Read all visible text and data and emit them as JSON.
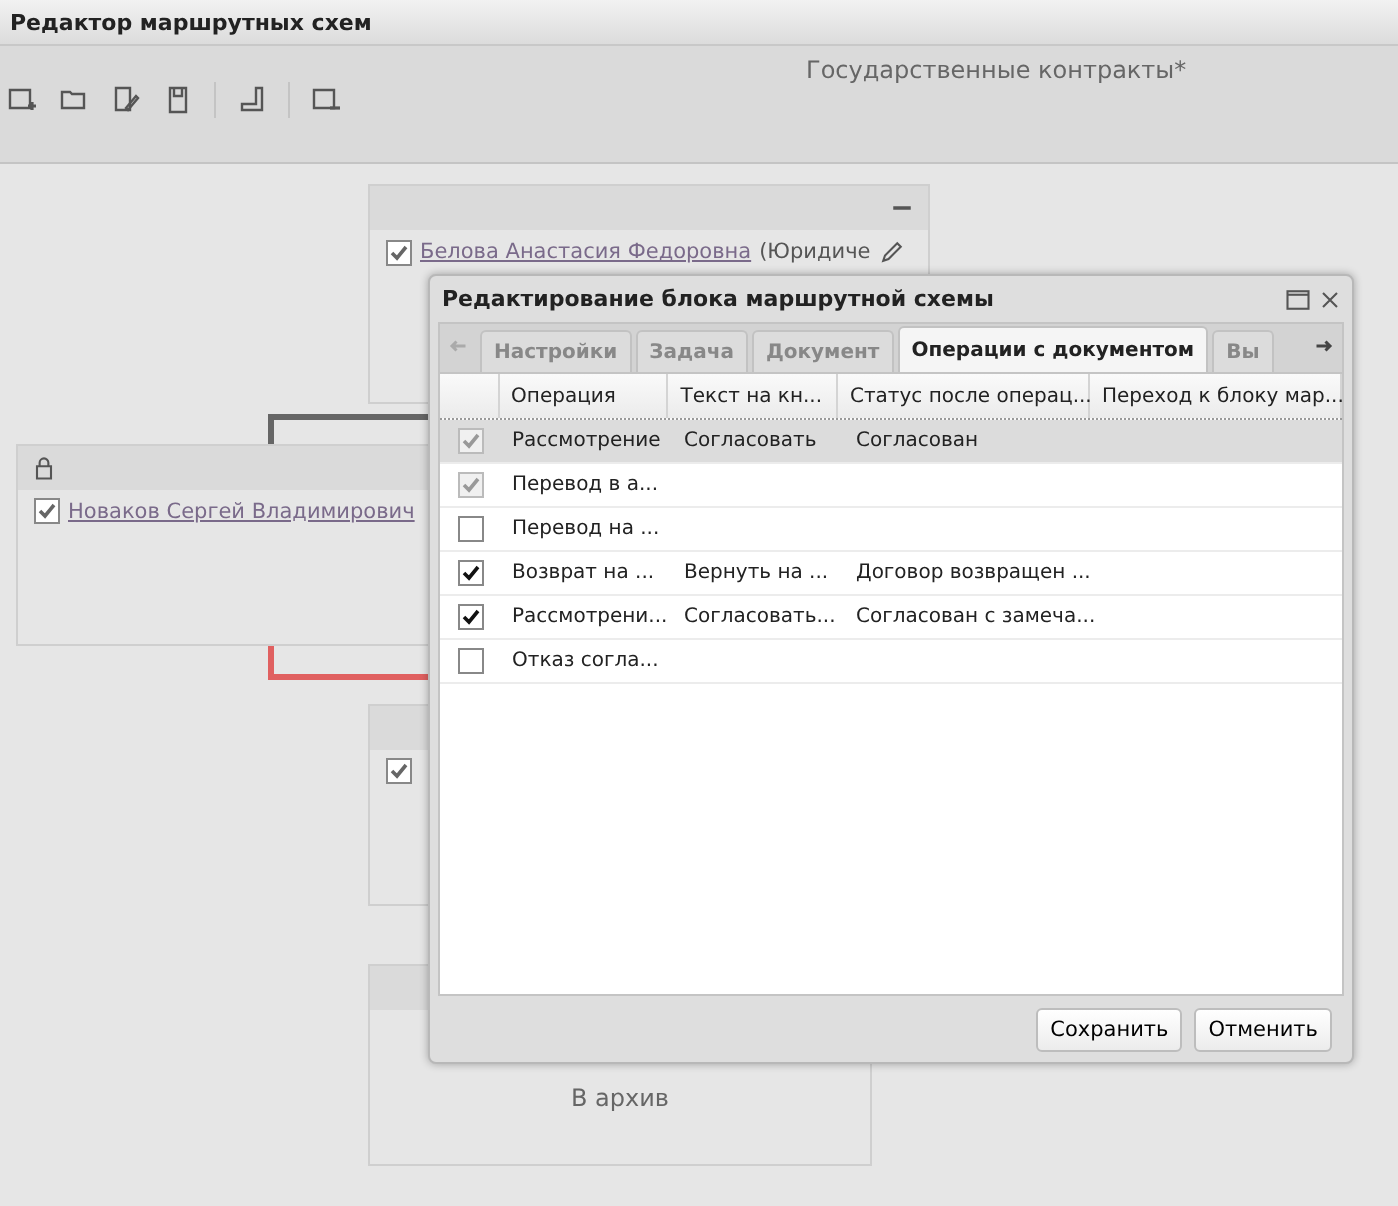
{
  "window": {
    "title": "Редактор маршрутных схем"
  },
  "toolbar": {
    "document_title": "Государственные контракты*"
  },
  "nodes": [
    {
      "name": "Белова Анастасия Федоровна",
      "role": "(Юридиче",
      "checked": true
    },
    {
      "name": "Новаков Сергей Владимирович",
      "checked": true
    },
    {
      "checked": true
    },
    {
      "label": "В архив"
    }
  ],
  "dialog": {
    "title": "Редактирование блока маршрутной схемы",
    "tabs": [
      {
        "label": "Настройки",
        "selected": false
      },
      {
        "label": "Задача",
        "selected": false
      },
      {
        "label": "Документ",
        "selected": false
      },
      {
        "label": "Операции с документом",
        "selected": true
      },
      {
        "label": "Вы",
        "selected": false
      }
    ],
    "columns": [
      "Операция",
      "Текст на кн...",
      "Статус после операц...",
      "Переход к блоку мар..."
    ],
    "rows": [
      {
        "checked": true,
        "disabled": true,
        "selected": true,
        "cells": [
          "Рассмотрение",
          "Согласовать",
          "Согласован"
        ]
      },
      {
        "checked": true,
        "disabled": true,
        "selected": false,
        "cells": [
          "Перевод в а..."
        ]
      },
      {
        "checked": false,
        "disabled": false,
        "selected": false,
        "cells": [
          "Перевод на ..."
        ]
      },
      {
        "checked": true,
        "disabled": false,
        "selected": false,
        "cells": [
          "Возврат на ...",
          "Вернуть на ...",
          "Договор возвращен ..."
        ]
      },
      {
        "checked": true,
        "disabled": false,
        "selected": false,
        "cells": [
          "Рассмотрени...",
          "Согласовать...",
          "Согласован с замеча..."
        ]
      },
      {
        "checked": false,
        "disabled": false,
        "selected": false,
        "cells": [
          "Отказ согла..."
        ]
      }
    ],
    "buttons": [
      "Сохранить",
      "Отменить"
    ]
  }
}
